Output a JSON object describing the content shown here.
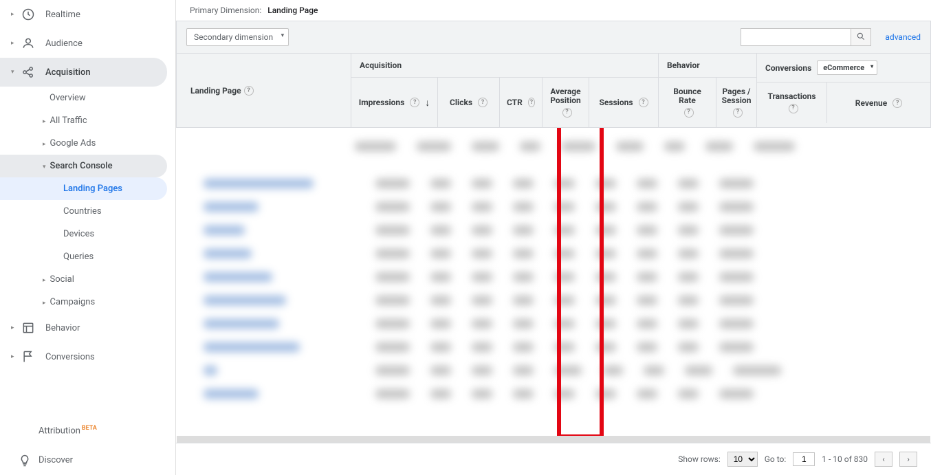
{
  "sidebar": {
    "items": [
      {
        "label": "Realtime",
        "icon": "clock-icon"
      },
      {
        "label": "Audience",
        "icon": "person-icon"
      },
      {
        "label": "Acquisition",
        "icon": "share-icon"
      },
      {
        "label": "Behavior",
        "icon": "layout-icon"
      },
      {
        "label": "Conversions",
        "icon": "flag-icon"
      }
    ],
    "acquisition_children": [
      {
        "label": "Overview"
      },
      {
        "label": "All Traffic"
      },
      {
        "label": "Google Ads"
      },
      {
        "label": "Search Console"
      },
      {
        "label": "Social"
      },
      {
        "label": "Campaigns"
      }
    ],
    "search_console_children": [
      {
        "label": "Landing Pages"
      },
      {
        "label": "Countries"
      },
      {
        "label": "Devices"
      },
      {
        "label": "Queries"
      }
    ],
    "bottom": [
      {
        "label": "Attribution",
        "badge": "BETA"
      },
      {
        "label": "Discover"
      }
    ]
  },
  "primary_dimension": {
    "label": "Primary Dimension:",
    "value": "Landing Page"
  },
  "secondary_dimension": {
    "label": "Secondary dimension"
  },
  "search": {
    "placeholder": ""
  },
  "advanced_label": "advanced",
  "columns": {
    "landing": "Landing Page",
    "acquisition_group": "Acquisition",
    "behavior_group": "Behavior",
    "conversions_group": "Conversions",
    "conversions_select": "eCommerce",
    "impressions": "Impressions",
    "clicks": "Clicks",
    "ctr": "CTR",
    "avg_position": "Average Position",
    "sessions": "Sessions",
    "bounce_rate": "Bounce Rate",
    "pages_per_session": "Pages / Session",
    "transactions": "Transactions",
    "revenue": "Revenue"
  },
  "footer": {
    "show_rows_label": "Show rows:",
    "show_rows_value": "10",
    "goto_label": "Go to:",
    "goto_value": "1",
    "range": "1 - 10 of 830"
  }
}
